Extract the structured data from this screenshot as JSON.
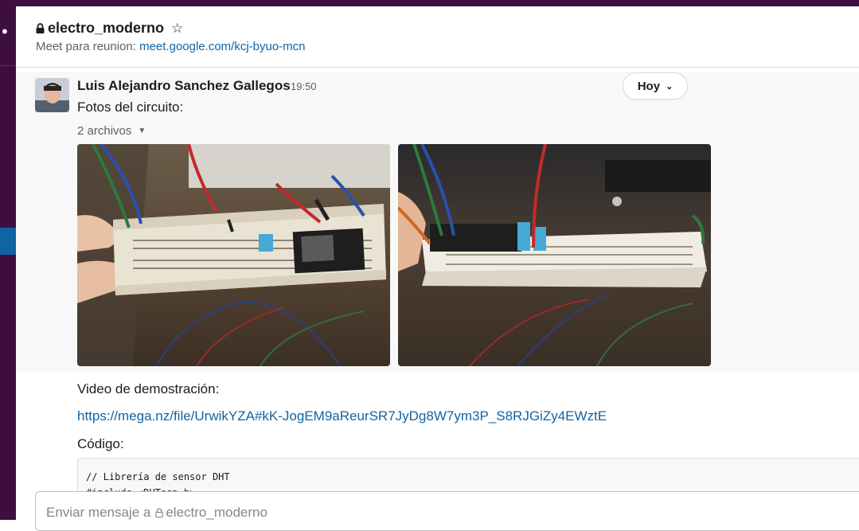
{
  "channel": {
    "name": "electro_moderno",
    "topic_label": "Meet para reunion:",
    "topic_link": "meet.google.com/kcj-byuo-mcn"
  },
  "icons": {
    "lock": "lock-icon",
    "star": "star-icon",
    "caret": "caret-down-icon",
    "chevron": "chevron-down-icon"
  },
  "colors": {
    "sidebar": "#3f0e40",
    "link": "#1264a3",
    "active_item": "#1164a3"
  },
  "message": {
    "author": "Luis Alejandro Sanchez Gallegos",
    "time": "19:50",
    "text": "Fotos del circuito:",
    "files_toggle": "2 archivos",
    "video_label": "Video de demostración:",
    "video_url": "https://mega.nz/file/UrwikYZA#kK-JogEM9aReurSR7JyDg8W7ym3P_S8RJGiZy4EWztE",
    "code_label": "Código:",
    "code_lines": [
      "// Librería de sensor DHT",
      "#include <DHTesp.h>"
    ]
  },
  "date_divider": "Hoy",
  "composer": {
    "placeholder_prefix": "Enviar mensaje a",
    "placeholder_channel": "electro_moderno"
  }
}
